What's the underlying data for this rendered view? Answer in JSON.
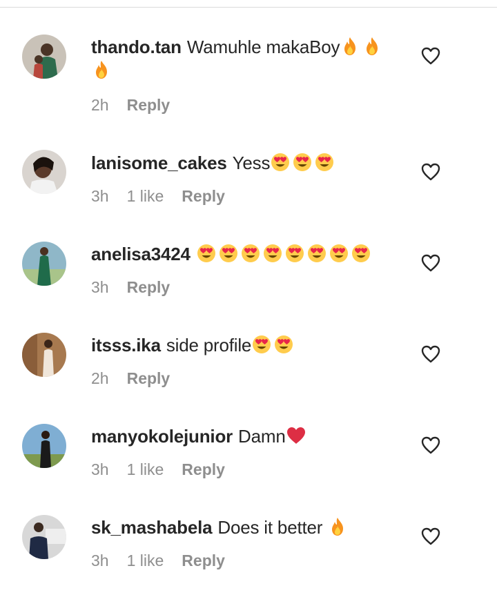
{
  "comments": [
    {
      "username": "thando.tan",
      "text": "Wamuhle makaBoy",
      "emoji_type": "fire",
      "emoji_count": 3,
      "time": "2h",
      "likes": "",
      "reply": "Reply",
      "avatar_bg": "#c9c2b8",
      "avatar_fg": "#2e6b4d"
    },
    {
      "username": "lanisome_cakes",
      "text": "Yess",
      "emoji_type": "heart-eyes",
      "emoji_count": 3,
      "time": "3h",
      "likes": "1 like",
      "reply": "Reply",
      "avatar_bg": "#d9d4cf",
      "avatar_fg": "#3b2a22"
    },
    {
      "username": "anelisa3424",
      "text": "",
      "emoji_type": "heart-eyes",
      "emoji_count": 8,
      "time": "3h",
      "likes": "",
      "reply": "Reply",
      "avatar_bg": "#8fb7c8",
      "avatar_fg": "#1f6b4a"
    },
    {
      "username": "itsss.ika",
      "text": "side profile",
      "emoji_type": "heart-eyes",
      "emoji_count": 2,
      "time": "2h",
      "likes": "",
      "reply": "Reply",
      "avatar_bg": "#a7794f",
      "avatar_fg": "#f0e6da"
    },
    {
      "username": "manyokolejunior",
      "text": "Damn",
      "emoji_type": "red-heart",
      "emoji_count": 1,
      "time": "3h",
      "likes": "1 like",
      "reply": "Reply",
      "avatar_bg": "#7faed3",
      "avatar_fg": "#1a1a1a"
    },
    {
      "username": "sk_mashabela",
      "text": "Does it better ",
      "emoji_type": "fire",
      "emoji_count": 1,
      "time": "3h",
      "likes": "1 like",
      "reply": "Reply",
      "avatar_bg": "#d8d8d8",
      "avatar_fg": "#1f2a44"
    }
  ],
  "icons": {
    "like": "heart-outline-icon"
  }
}
